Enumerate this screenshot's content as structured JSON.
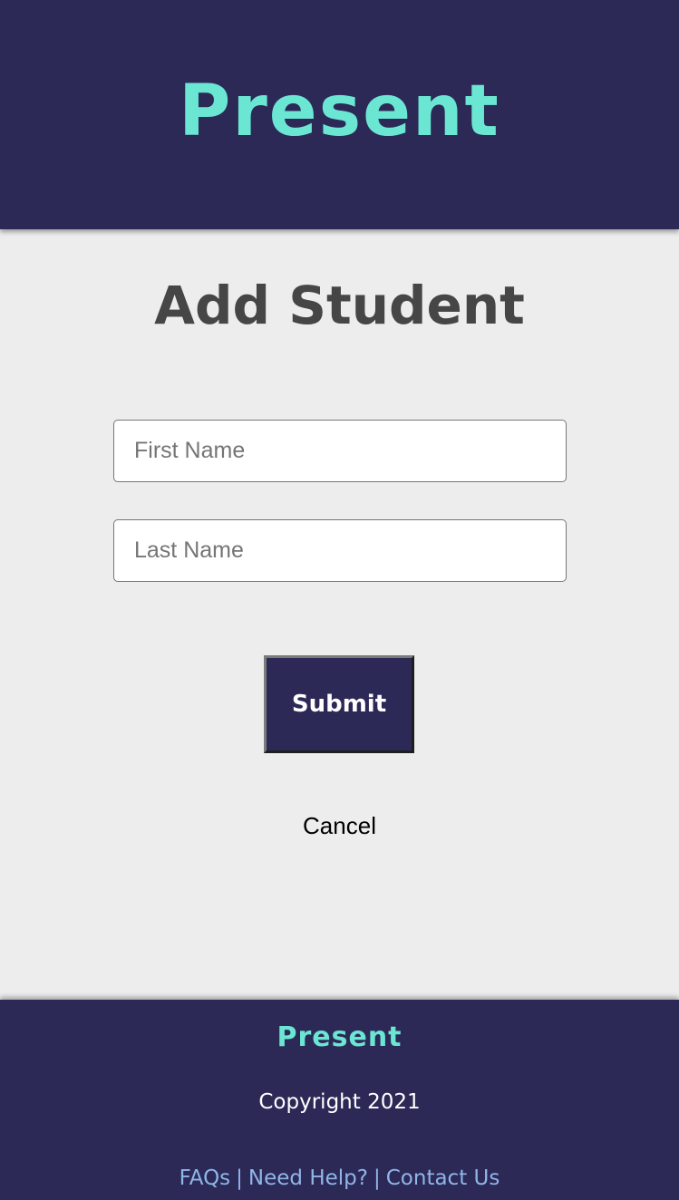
{
  "header": {
    "brand": "Present"
  },
  "main": {
    "title": "Add Student",
    "first_name_placeholder": "First Name",
    "last_name_placeholder": "Last Name",
    "submit_label": "Submit",
    "cancel_label": "Cancel"
  },
  "footer": {
    "brand": "Present",
    "copyright": "Copyright 2021",
    "links": [
      "FAQs",
      "Need Help?",
      "Contact Us"
    ],
    "separator": "|"
  },
  "colors": {
    "brand_navy": "#2c2957",
    "brand_teal": "#6be6d3",
    "link_blue": "#8fb6e8",
    "background": "#ededed"
  }
}
